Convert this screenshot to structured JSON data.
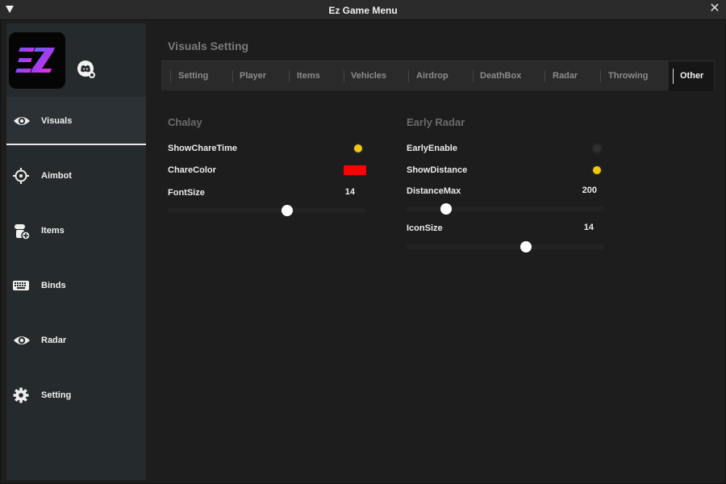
{
  "window": {
    "title": "Ez Game Menu"
  },
  "sidebar": {
    "logo_text": "EZ",
    "items": [
      {
        "label": "Visuals",
        "icon": "eye-icon",
        "active": true
      },
      {
        "label": "Aimbot",
        "icon": "crosshair-icon",
        "active": false
      },
      {
        "label": "Items",
        "icon": "items-add-icon",
        "active": false
      },
      {
        "label": "Binds",
        "icon": "keyboard-icon",
        "active": false
      },
      {
        "label": "Radar",
        "icon": "eye-icon",
        "active": false
      },
      {
        "label": "Setting",
        "icon": "gear-icon",
        "active": false
      }
    ]
  },
  "panel": {
    "title": "Visuals Setting"
  },
  "tabs": [
    {
      "label": "Setting"
    },
    {
      "label": "Player"
    },
    {
      "label": "Items"
    },
    {
      "label": "Vehicles"
    },
    {
      "label": "Airdrop"
    },
    {
      "label": "DeathBox"
    },
    {
      "label": "Radar"
    },
    {
      "label": "Throwing"
    },
    {
      "label": "Other",
      "active": true
    }
  ],
  "chalay": {
    "title": "Chalay",
    "show_chare_time": {
      "label": "ShowChareTime",
      "on": true
    },
    "chare_color": {
      "label": "ChareColor",
      "color": "#ff0000"
    },
    "font_size": {
      "label": "FontSize",
      "value": "14",
      "level": 0.6
    }
  },
  "early_radar": {
    "title": "Early Radar",
    "early_enable": {
      "label": "EarlyEnable",
      "on": false
    },
    "show_distance": {
      "label": "ShowDistance",
      "on": true
    },
    "distance_max": {
      "label": "DistanceMax",
      "value": "200",
      "level": 0.2
    },
    "icon_size": {
      "label": "IconSize",
      "value": "14",
      "level": 0.6
    }
  },
  "colors": {
    "toggle_on": "#f2c80f",
    "accent_white": "#ffffff",
    "swatch": "#ff0000"
  }
}
